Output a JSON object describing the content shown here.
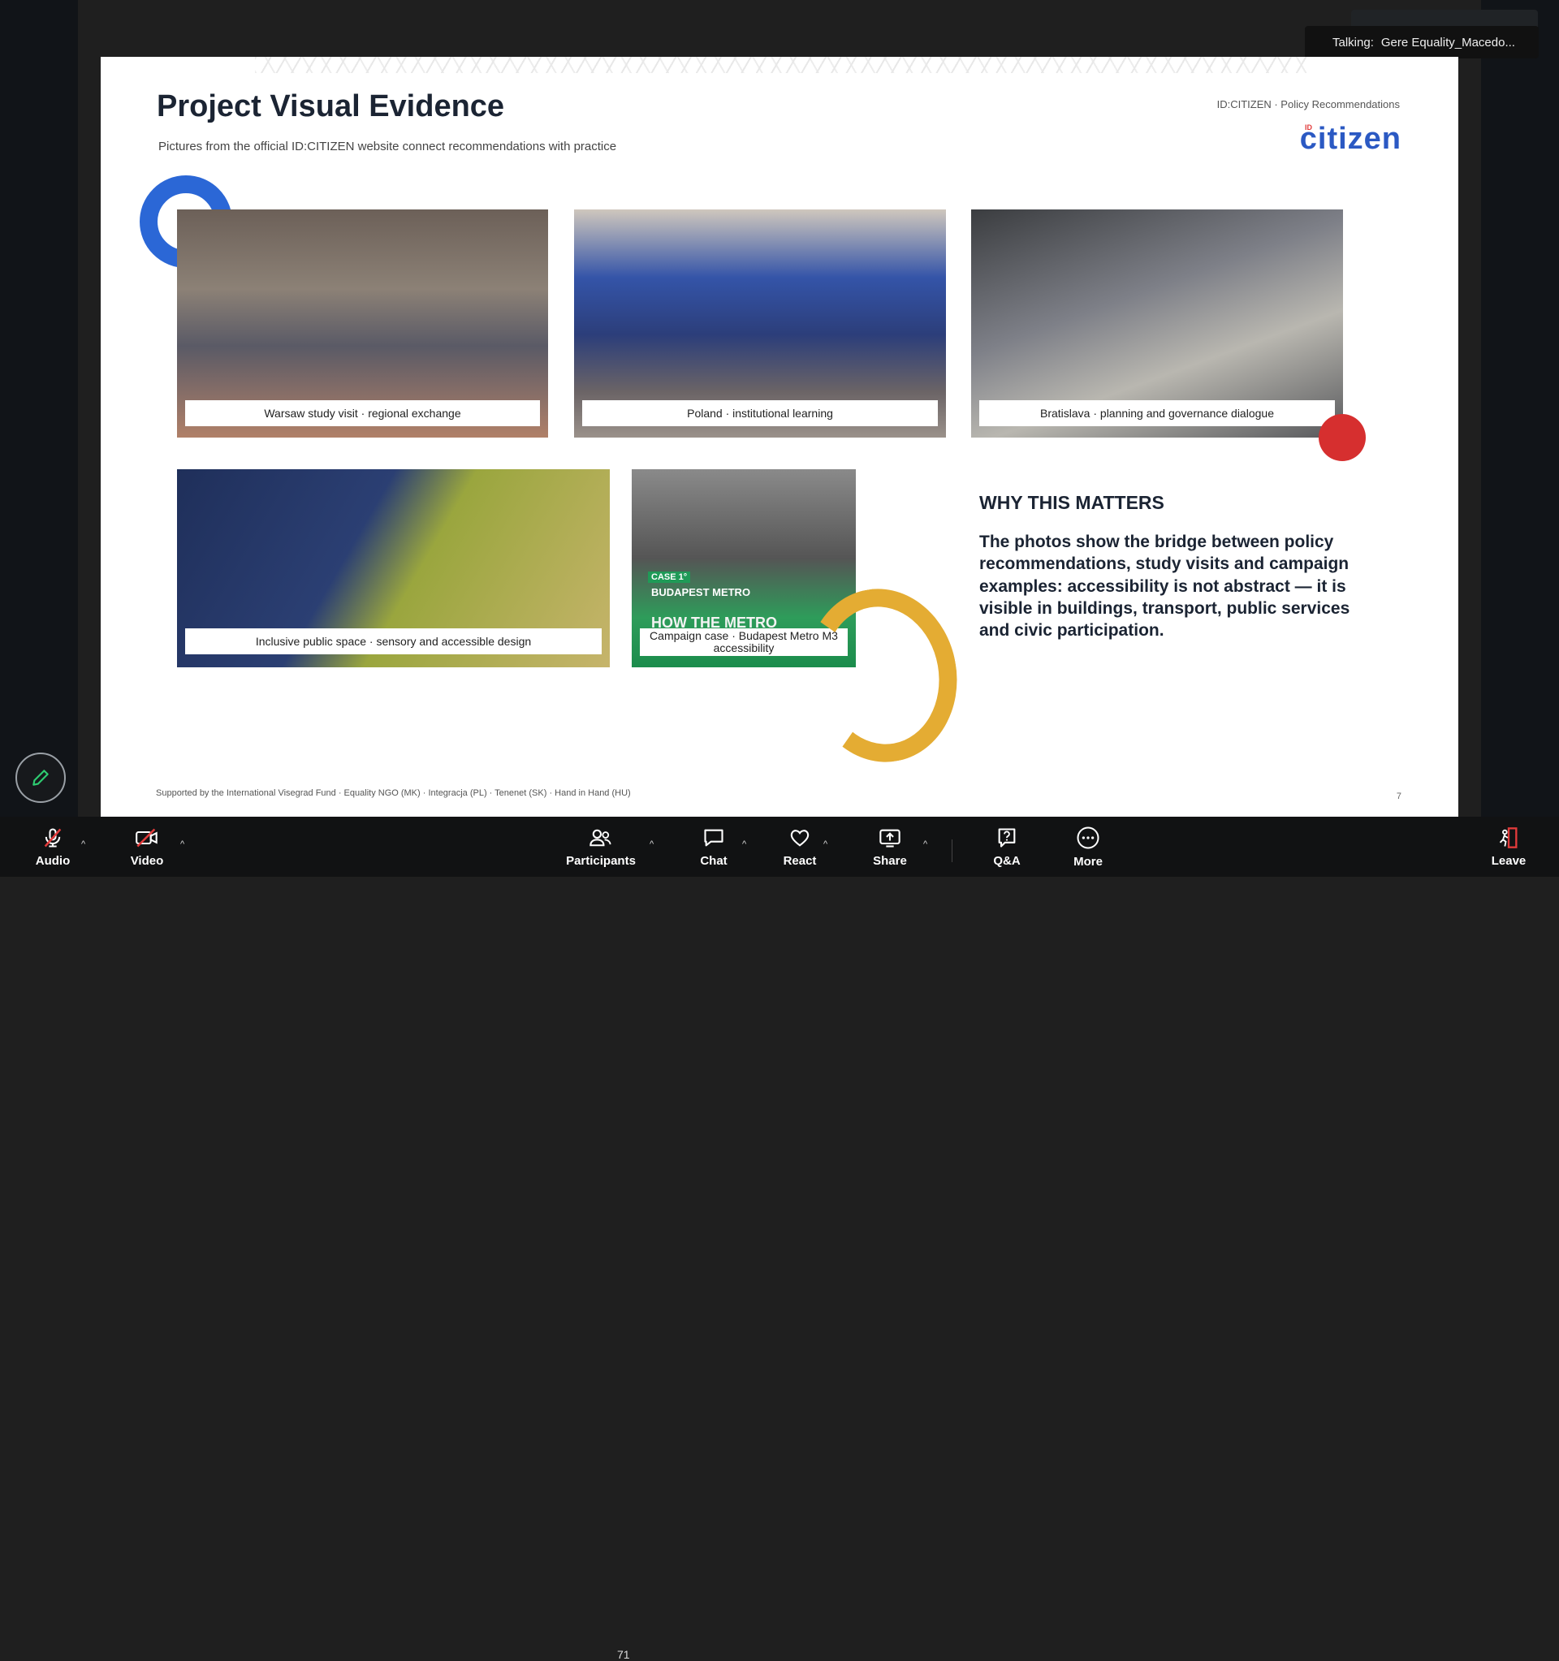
{
  "talking": {
    "label": "Talking:",
    "names": "Gere  Equality_Macedo..."
  },
  "slide": {
    "title": "Project Visual Evidence",
    "subtitle": "Pictures from the official ID:CITIZEN website connect recommendations with practice",
    "tag": "ID:CITIZEN · Policy Recommendations",
    "logo": "citizen",
    "logo_mini": "ID",
    "photos": [
      {
        "caption": "Warsaw study visit · regional exchange"
      },
      {
        "caption": "Poland · institutional learning"
      },
      {
        "caption": "Bratislava · planning and governance dialogue"
      },
      {
        "caption": "Inclusive public space · sensory and accessible design"
      },
      {
        "caption": "Campaign case · Budapest Metro M3 accessibility",
        "case_label": "CASE 1°",
        "case_city": "BUDAPEST METRO",
        "case_head": "HOW THE METRO ACCESSIBLE?"
      }
    ],
    "why_title": "WHY THIS MATTERS",
    "why_text": "The photos show the bridge between policy recommendations, study visits and campaign examples: accessibility is not abstract — it is visible in buildings, transport, public services and civic participation.",
    "footer": "Supported by the International Visegrad Fund · Equality NGO (MK) · Integracja (PL) · Tenenet (SK) · Hand in Hand (HU)",
    "page_number": "7"
  },
  "toolbar": {
    "audio": "Audio",
    "video": "Video",
    "participants": "Participants",
    "participant_count": "71",
    "chat": "Chat",
    "react": "React",
    "share": "Share",
    "qa": "Q&A",
    "more": "More",
    "leave": "Leave"
  },
  "colors": {
    "accent_blue": "#2b67d6",
    "accent_red": "#d62f2f",
    "accent_yellow": "#e4ac33",
    "leave_red": "#e23b3b"
  }
}
